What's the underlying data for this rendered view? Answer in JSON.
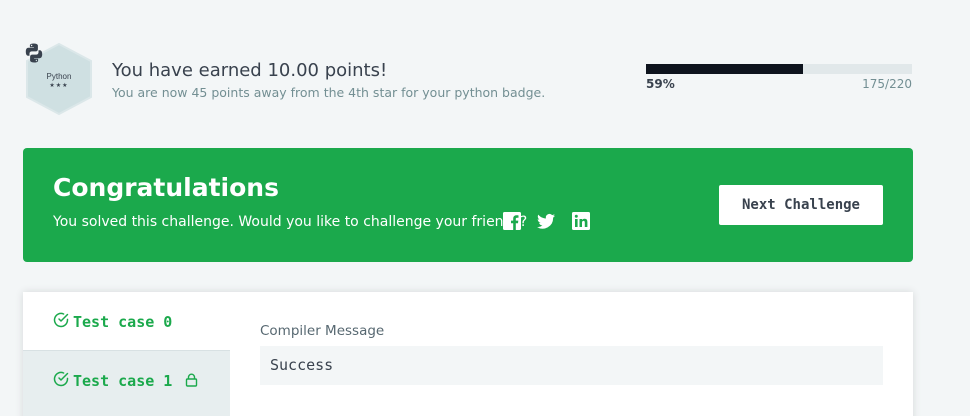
{
  "badge": {
    "name": "Python",
    "stars": "★★★",
    "icon": "python-logo-icon",
    "color": "#c9dadc"
  },
  "earned": {
    "title": "You have earned 10.00 points!",
    "subtitle": "You are now 45 points away from the 4th star for your python badge."
  },
  "progress": {
    "percent_label": "59%",
    "count_label": "175/220",
    "fraction": 0.59
  },
  "congrats": {
    "title": "Congratulations",
    "subtitle": "You solved this challenge. Would you like to challenge your friends?",
    "next_button": "Next Challenge",
    "background": "#1ba94c",
    "social": [
      "facebook-icon",
      "twitter-icon",
      "linkedin-icon"
    ]
  },
  "results": {
    "tabs": [
      {
        "label": "Test case 0",
        "status": "passed",
        "locked": false
      },
      {
        "label": "Test case 1",
        "status": "passed",
        "locked": true
      }
    ],
    "compiler_label": "Compiler Message",
    "compiler_message": "Success"
  }
}
